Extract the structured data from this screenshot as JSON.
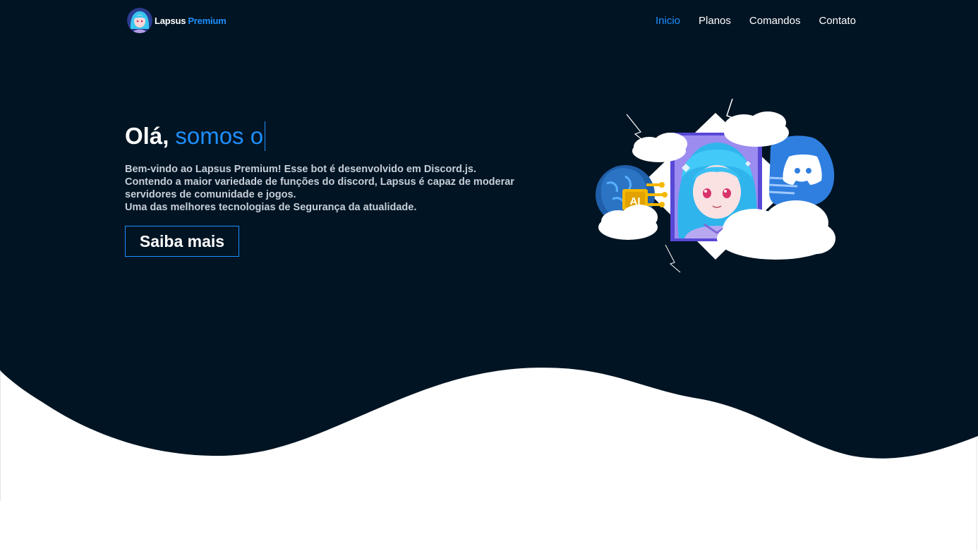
{
  "header": {
    "brand_name": "Lapsus",
    "brand_accent": "Premium",
    "nav": [
      {
        "label": "Inicio",
        "active": true
      },
      {
        "label": "Planos",
        "active": false
      },
      {
        "label": "Comandos",
        "active": false
      },
      {
        "label": "Contato",
        "active": false
      }
    ]
  },
  "hero": {
    "title_prefix": "Olá,",
    "title_accent": "somos o",
    "description_lines": [
      "Bem-vindo ao Lapsus Premium! Esse bot é desenvolvido em Discord.js.",
      "Contendo a maior variedade de funções do discord, Lapsus é capaz de moderar",
      "servidores de comunidade e jogos.",
      "Uma das melhores tecnologias de Segurança da atualidade."
    ],
    "cta_label": "Saiba mais",
    "illustration": {
      "badge_text": "AI",
      "icons": [
        "brain-ai-icon",
        "anime-avatar",
        "discord-icon",
        "cloud-icon"
      ]
    }
  },
  "colors": {
    "background_dark": "#011423",
    "accent": "#1e8fff",
    "text": "#ffffff",
    "text_muted": "#c7ced8",
    "discord": "#2f7fe0"
  }
}
